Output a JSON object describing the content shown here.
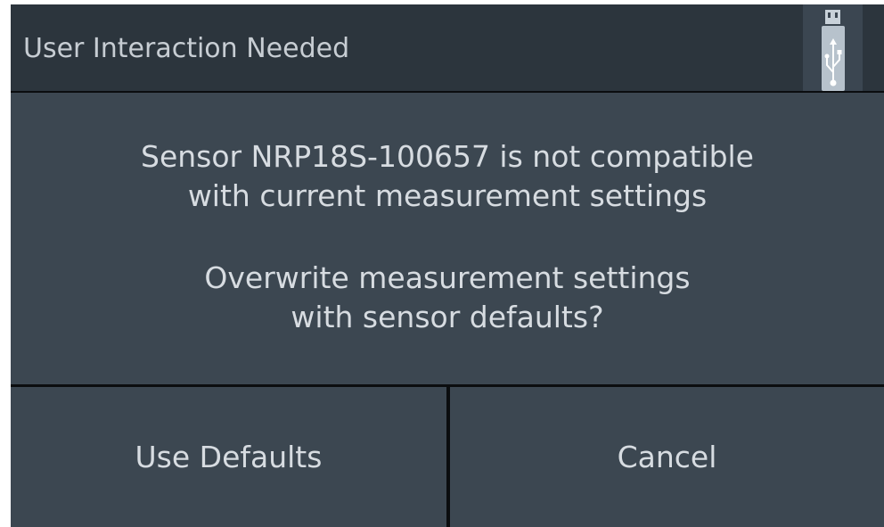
{
  "dialog": {
    "title": "User Interaction Needed",
    "status_icon": "usb-icon",
    "message": {
      "line1": "Sensor NRP18S-100657 is not compatible",
      "line2": "with current measurement settings",
      "line3": "Overwrite measurement settings",
      "line4": "with sensor defaults?"
    },
    "buttons": {
      "use_defaults": "Use Defaults",
      "cancel": "Cancel"
    }
  },
  "colors": {
    "header_bg": "#2c353d",
    "panel_bg": "#3c4751",
    "icon_bg": "#3b4651",
    "icon_fg": "#b7c2cc",
    "text": "#d7dce1",
    "separator": "#0b0d0f"
  }
}
